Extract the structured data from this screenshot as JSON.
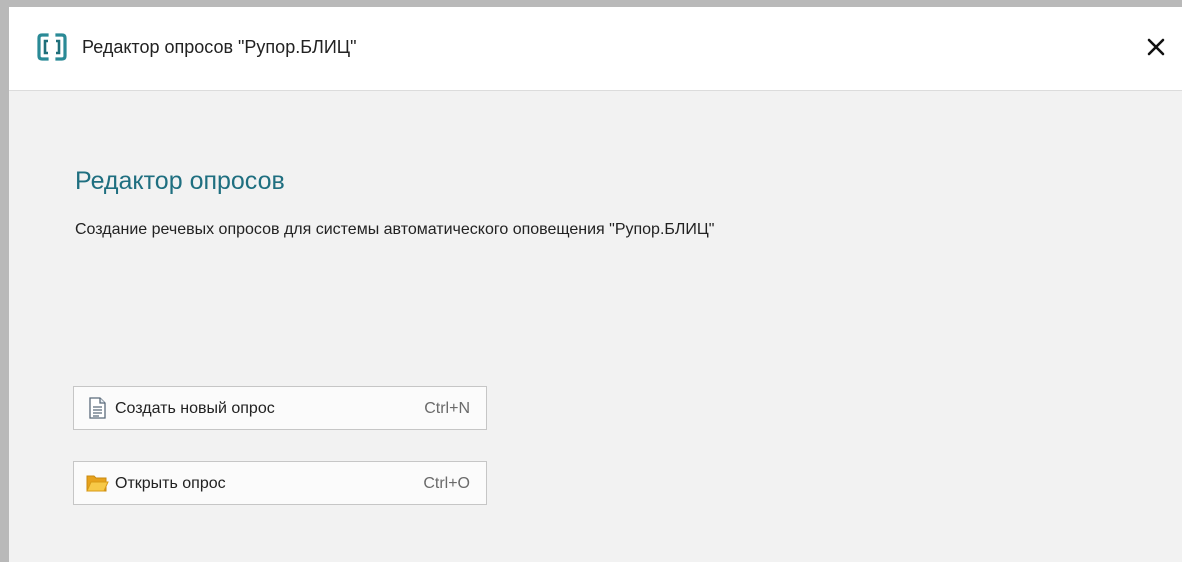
{
  "window": {
    "title": "Редактор опросов \"Рупор.БЛИЦ\"",
    "logo_icon": "bracket-logo-icon",
    "close_icon": "close-icon"
  },
  "main": {
    "heading": "Редактор опросов",
    "description": "Создание речевых опросов для системы автоматического оповещения \"Рупор.БЛИЦ\""
  },
  "actions": [
    {
      "label": "Создать новый опрос",
      "shortcut": "Ctrl+N",
      "icon": "new-document-icon"
    },
    {
      "label": "Открыть опрос",
      "shortcut": "Ctrl+O",
      "icon": "open-folder-icon"
    }
  ],
  "colors": {
    "accent": "#1f6f80",
    "logo": "#2a8a96",
    "folder": "#f0b429"
  }
}
